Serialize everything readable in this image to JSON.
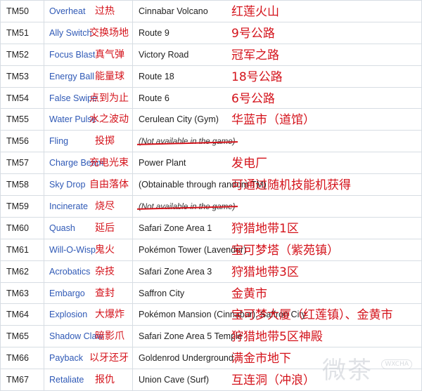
{
  "rows": [
    {
      "tm": "TM50",
      "move": "Overheat",
      "move_cn": "过热",
      "location": "Cinnabar Volcano",
      "location_cn": "红莲火山",
      "unavailable": false
    },
    {
      "tm": "TM51",
      "move": "Ally Switch",
      "move_cn": "交换场地",
      "location": "Route 9",
      "location_cn": "9号公路",
      "unavailable": false
    },
    {
      "tm": "TM52",
      "move": "Focus Blast",
      "move_cn": "真气弹",
      "location": "Victory Road",
      "location_cn": "冠军之路",
      "unavailable": false
    },
    {
      "tm": "TM53",
      "move": "Energy Ball",
      "move_cn": "能量球",
      "location": "Route 18",
      "location_cn": "18号公路",
      "unavailable": false
    },
    {
      "tm": "TM54",
      "move": "False Swipe",
      "move_cn": "点到为止",
      "location": "Route 6",
      "location_cn": "6号公路",
      "unavailable": false
    },
    {
      "tm": "TM55",
      "move": "Water Pulse",
      "move_cn": "水之波动",
      "location": "Cerulean City (Gym)",
      "location_cn": "华蓝市（道馆）",
      "unavailable": false
    },
    {
      "tm": "TM56",
      "move": "Fling",
      "move_cn": "投掷",
      "location": "(Not available in the game)",
      "location_cn": "",
      "unavailable": true
    },
    {
      "tm": "TM57",
      "move": "Charge Beam",
      "move_cn": "充电光束",
      "location": "Power Plant",
      "location_cn": "发电厂",
      "unavailable": false
    },
    {
      "tm": "TM58",
      "move": "Sky Drop",
      "move_cn": "自由落体",
      "location": "(Obtainable through random TM)",
      "location_cn": "可通过随机技能机获得",
      "unavailable": false
    },
    {
      "tm": "TM59",
      "move": "Incinerate",
      "move_cn": "烧尽",
      "location": "(Not available in the game)",
      "location_cn": "",
      "unavailable": true
    },
    {
      "tm": "TM60",
      "move": "Quash",
      "move_cn": "延后",
      "location": "Safari Zone Area 1",
      "location_cn": "狩猎地带1区",
      "unavailable": false
    },
    {
      "tm": "TM61",
      "move": "Will-O-Wisp",
      "move_cn": "鬼火",
      "location": "Pokémon Tower (Lavender)",
      "location_cn": "宝可梦塔（紫苑镇）",
      "unavailable": false
    },
    {
      "tm": "TM62",
      "move": "Acrobatics",
      "move_cn": "杂技",
      "location": "Safari Zone Area 3",
      "location_cn": "狩猎地带3区",
      "unavailable": false
    },
    {
      "tm": "TM63",
      "move": "Embargo",
      "move_cn": "查封",
      "location": "Saffron City",
      "location_cn": "金黄市",
      "unavailable": false
    },
    {
      "tm": "TM64",
      "move": "Explosion",
      "move_cn": "大爆炸",
      "location": "Pokémon Mansion (Cinnabar), Saffron City",
      "location_cn": "宝可梦大厦（红莲镇）、金黄市",
      "unavailable": false
    },
    {
      "tm": "TM65",
      "move": "Shadow Claw",
      "move_cn": "暗影爪",
      "location": "Safari Zone Area 5 Temple",
      "location_cn": "狩猎地带5区神殿",
      "unavailable": false
    },
    {
      "tm": "TM66",
      "move": "Payback",
      "move_cn": "以牙还牙",
      "location": "Goldenrod Underground",
      "location_cn": "满金市地下",
      "unavailable": false
    },
    {
      "tm": "TM67",
      "move": "Retaliate",
      "move_cn": "报仇",
      "location": "Union Cave (Surf)",
      "location_cn": "互连洞（冲浪）",
      "unavailable": false
    }
  ],
  "watermark": {
    "text": "微茶",
    "badge": "WXCHA"
  }
}
